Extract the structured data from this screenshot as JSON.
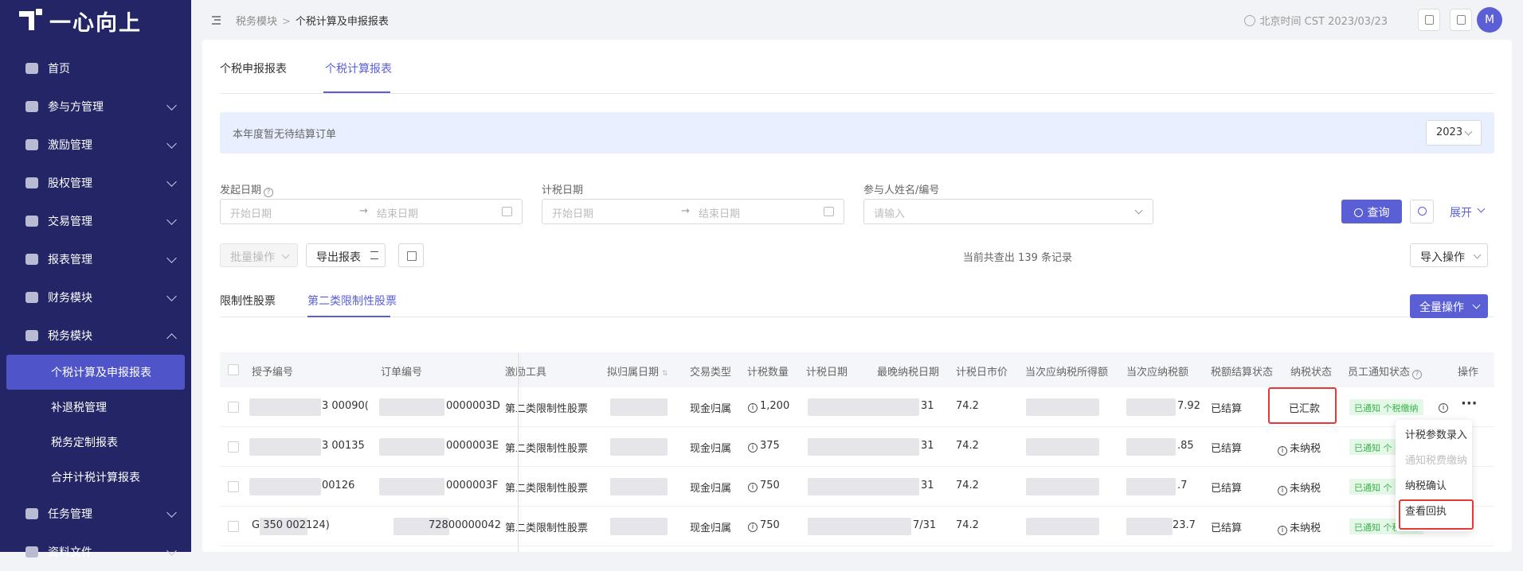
{
  "app": {
    "logo_text": "一心向上"
  },
  "sidebar": {
    "items": [
      {
        "label": "首页",
        "icon": "home-icon"
      },
      {
        "label": "参与方管理",
        "icon": "users-icon"
      },
      {
        "label": "激励管理",
        "icon": "incentive-icon"
      },
      {
        "label": "股权管理",
        "icon": "equity-icon"
      },
      {
        "label": "交易管理",
        "icon": "trade-icon"
      },
      {
        "label": "报表管理",
        "icon": "report-icon"
      },
      {
        "label": "财务模块",
        "icon": "finance-icon"
      },
      {
        "label": "税务模块",
        "icon": "tax-icon"
      }
    ],
    "tax_sub": [
      "个税计算及申报报表",
      "补退税管理",
      "税务定制报表",
      "合并计税计算报表"
    ],
    "more": [
      {
        "label": "任务管理"
      },
      {
        "label": "资料文件"
      }
    ]
  },
  "topbar": {
    "crumb_parent": "税务模块",
    "crumb_sep": ">",
    "crumb_current": "个税计算及申报报表",
    "time": "北京时间 CST 2023/03/23",
    "avatar": "M"
  },
  "page_tabs": [
    "个税申报报表",
    "个税计算报表"
  ],
  "notice": {
    "text": "本年度暂无待结算订单",
    "year": "2023"
  },
  "filters": {
    "launch_date": {
      "label": "发起日期",
      "start": "开始日期",
      "arrow": "→",
      "end": "结束日期"
    },
    "tax_date": {
      "label": "计税日期",
      "start": "开始日期",
      "arrow": "→",
      "end": "结束日期"
    },
    "participant": {
      "label": "参与人姓名/编号",
      "placeholder": "请输入"
    },
    "query": "查询",
    "expand": "展开"
  },
  "toolbar": {
    "batch": "批量操作",
    "export": "导出报表",
    "count": "当前共查出 139 条记录",
    "import": "导入操作"
  },
  "sub_tabs": [
    "限制性股票",
    "第二类限制性股票"
  ],
  "full_op": "全量操作",
  "table": {
    "headers": [
      "授予编号",
      "订单编号",
      "激励工具",
      "拟归属日期",
      "交易类型",
      "计税数量",
      "计税日期",
      "最晚纳税日期",
      "计税日市价",
      "当次应纳税所得额",
      "当次应纳税额",
      "税额结算状态",
      "纳税状态",
      "员工通知状态",
      "操作"
    ],
    "rows": [
      {
        "grant": "3 00090(",
        "order": "0000003D",
        "tool": "第二类限制性股票",
        "type": "现金归属",
        "qty": "1,200",
        "latest": "31",
        "price": "74.2",
        "tax": "7.92",
        "settle": "已结算",
        "pay": "已汇款",
        "notify": "已通知 个税缴纳"
      },
      {
        "grant": "3 00135",
        "order": "0000003E",
        "tool": "第二类限制性股票",
        "type": "现金归属",
        "qty": "375",
        "latest": "31",
        "price": "74.2",
        "tax": ".85",
        "settle": "已结算",
        "pay": "未纳税",
        "notify": "已通知 个"
      },
      {
        "grant": "00126",
        "order": "0000003F",
        "tool": "第二类限制性股票",
        "type": "现金归属",
        "qty": "750",
        "latest": "31",
        "price": "74.2",
        "tax": ".7",
        "settle": "已结算",
        "pay": "未纳税",
        "notify": "已通知 个"
      },
      {
        "grant": "G 350 002124)",
        "order": "72800000042",
        "tool": "第二类限制性股票",
        "type": "现金归属",
        "qty": "750",
        "latest": "7/31",
        "price": "74.2",
        "tax": "23.7",
        "settle": "已结算",
        "pay": "未纳税",
        "notify": "已通知 个税缴纳"
      }
    ]
  },
  "row_menu": {
    "items": [
      "计税参数录入",
      "通知税费缴纳",
      "纳税确认",
      "查看回执"
    ]
  },
  "colors": {
    "sidebar": "#232566",
    "accent": "#5a5fd6",
    "highlight": "#e53935"
  }
}
